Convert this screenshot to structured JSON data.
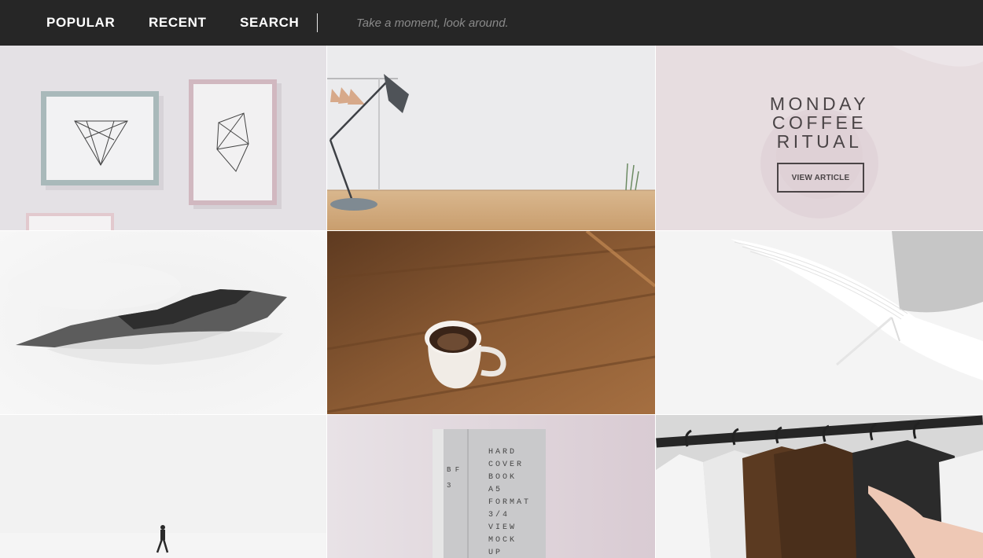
{
  "nav": {
    "links": [
      "POPULAR",
      "RECENT",
      "SEARCH"
    ],
    "tagline": "Take a moment, look around."
  },
  "feature": {
    "title_lines": [
      "MONDAY",
      "COFFEE",
      "RITUAL"
    ],
    "button_label": "VIEW ARTICLE"
  },
  "book_cover": {
    "lines": [
      "HARD",
      "COVER",
      "BOOK",
      "A5",
      "FORMAT",
      "3/4",
      "VIEW",
      "MOCK",
      "UP"
    ],
    "spine": "B  F  3"
  },
  "colors": {
    "nav_bg": "#262626",
    "feature_bg": "#e7dde0",
    "accent_text": "#4a4446"
  }
}
